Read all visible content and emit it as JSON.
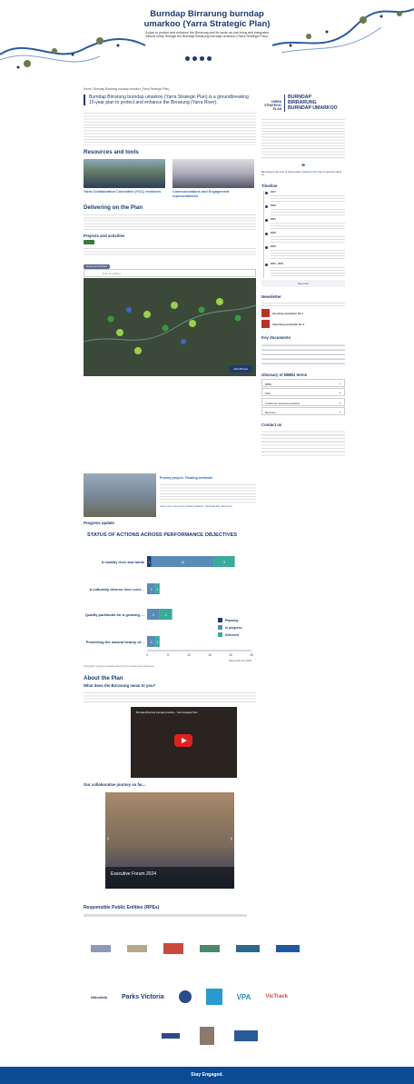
{
  "hero": {
    "title": "Burndap Birrarung burndap umarkoo (Yarra Strategic Plan)",
    "subtitle": "A plan to protect and enhance the Birrarung and its lands as one living and integrated natural entity through the Burndap Birrarung burndap umarkoo (Yarra Strategic Plan)."
  },
  "breadcrumb": "Home / Burndap Birrarung burndap umarkoo (Yarra Strategic Plan)",
  "intro": "Burndap Birrarung burndap umarkoo (Yarra Strategic Plan) is a groundbreaking 10-year plan to protect and enhance the Birrarung (Yarra River).",
  "resources": {
    "heading": "Resources and tools",
    "cards": [
      {
        "label": "Yarra Collaboration Committee (YCC) members"
      },
      {
        "label": "Communications and Engagement representatives"
      }
    ]
  },
  "delivering": {
    "heading": "Delivering on the Plan"
  },
  "projects": {
    "heading": "Projects and activities",
    "view_button": "Projects and activities",
    "search_placeholder": "Enter an address",
    "add_button": "Add Photos"
  },
  "priority": {
    "title": "Priority project: Floating wetlands",
    "link": "Learn more: Community floating wetlands - Wilstrada Pde, Richmond"
  },
  "progress": {
    "heading": "Progress update",
    "chart_title": "STATUS OF ACTIONS ACROSS PERFORMANCE OBJECTIVES",
    "note": "Data at 30 June 2023",
    "footnote": "Infographic: progress towards achieving the performance objectives"
  },
  "chart_data": {
    "type": "bar",
    "title": "STATUS OF ACTIONS ACROSS PERFORMANCE OBJECTIVES",
    "categories": [
      "A healthy river and lands",
      "A culturally diverse river corridor",
      "Quality parklands for a growing population",
      "Protecting the natural beauty of the Yarra River corridor"
    ],
    "series": [
      {
        "name": "Planning",
        "values": [
          1,
          0,
          0,
          0
        ]
      },
      {
        "name": "In progress",
        "values": [
          15,
          2,
          3,
          2
        ]
      },
      {
        "name": "Delivered",
        "values": [
          5,
          1,
          3,
          1
        ]
      }
    ],
    "xlim": [
      0,
      25
    ],
    "xticks": [
      0,
      5,
      10,
      15,
      20,
      25
    ],
    "colors": {
      "Planning": "#1d3a73",
      "In progress": "#5a8ab8",
      "Delivered": "#3aaa9a"
    }
  },
  "about": {
    "heading": "About the Plan",
    "subheading": "What does the Birrarung mean to you?",
    "video_title": "Burndap Birrarung burndap umarkoo - Yarra Strategic Plan",
    "journey": "Our collaborative journey so far...",
    "slide_caption": "Executive Forum 2024"
  },
  "rpe": {
    "heading": "Responsible Public Entities (RPEs)",
    "logos": [
      "Parks Victoria",
      "Nillumbik",
      "VPA",
      "VicTrack",
      "Melbourne Water",
      "MELBOURNE"
    ]
  },
  "side": {
    "plan_title": "BURNDAP BIRRARUNG BURNDAP UMARKOO",
    "plan_sub": "YARRA STRATEGIC PLAN",
    "quote": "Birrarung is the river of living water. Caring for the river is good for all of us.",
    "timeline": {
      "heading": "Timeline",
      "items": [
        "2017",
        "2020",
        "2021",
        "2022",
        "2023",
        "2024 - 2034"
      ],
      "see_more": "See more"
    },
    "newsletter": {
      "heading": "Newsletter",
      "items": [
        "Incoming newsletter No 1",
        "Upcoming newsletter No 2"
      ]
    },
    "keydocs": {
      "heading": "Key documents"
    },
    "glossary": {
      "heading": "Glossary of BBBU terms",
      "items": [
        "BBBU",
        "RPE",
        "Traditional Owners/Custodians",
        "Birrarung"
      ]
    },
    "contact": {
      "heading": "Contact us"
    }
  },
  "footer": "Stay Engaged."
}
